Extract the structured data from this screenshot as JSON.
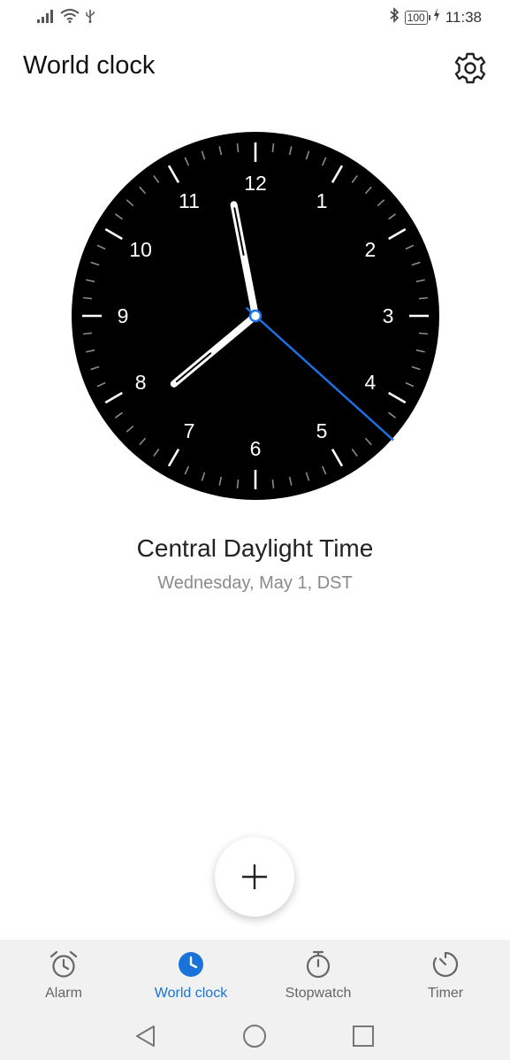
{
  "status": {
    "battery": "100",
    "time": "11:38"
  },
  "header": {
    "title": "World clock"
  },
  "clock": {
    "numerals": [
      "12",
      "1",
      "2",
      "3",
      "4",
      "5",
      "6",
      "7",
      "8",
      "9",
      "10",
      "11"
    ],
    "time_hours": 11,
    "time_minutes": 38,
    "time_seconds": 22,
    "accent_color": "#1a73e8"
  },
  "timezone": {
    "name": "Central Daylight Time",
    "date": "Wednesday, May 1, DST"
  },
  "nav": {
    "tabs": [
      {
        "label": "Alarm",
        "icon": "alarm-icon",
        "active": false
      },
      {
        "label": "World clock",
        "icon": "world-clock-icon",
        "active": true
      },
      {
        "label": "Stopwatch",
        "icon": "stopwatch-icon",
        "active": false
      },
      {
        "label": "Timer",
        "icon": "timer-icon",
        "active": false
      }
    ]
  },
  "colors": {
    "accent": "#1a73d9",
    "clock_face": "#000000",
    "nav_bg": "#f1f1f1"
  }
}
